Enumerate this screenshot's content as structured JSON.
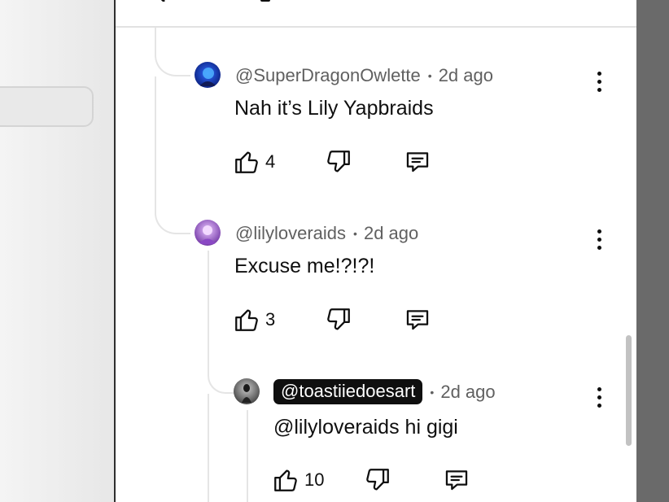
{
  "comments": [
    {
      "author": "@SuperDragonOwlette",
      "time": "2d ago",
      "text": "Nah it’s Lily Yapbraids",
      "likes": "4",
      "avatar_icon": "user-avatar",
      "avatar_colors": [
        "#0b1e7a",
        "#2f6bff"
      ]
    },
    {
      "author": "@lilyloveraids",
      "time": "2d ago",
      "text": "Excuse me!?!?!",
      "likes": "3",
      "avatar_icon": "user-avatar",
      "avatar_colors": [
        "#6b2fa0",
        "#d79ef0"
      ]
    },
    {
      "author": "@toastiiedoesart",
      "time": "2d ago",
      "text": "@lilyloveraids hi gigi",
      "likes": "10",
      "avatar_icon": "user-avatar",
      "avatar_colors": [
        "#3a3a3a",
        "#9a9a9a"
      ],
      "author_highlighted": true
    }
  ],
  "separator": "•",
  "icons": {
    "like": "thumbs-up-icon",
    "dislike": "thumbs-down-icon",
    "reply": "reply-comment-icon",
    "more": "more-vertical-icon"
  },
  "colors": {
    "text": "#0f0f0f",
    "secondary_text": "#606060",
    "highlight_bg": "#0f0f0f",
    "thread_line": "#e5e5e5",
    "right_strip": "#6a6a6a"
  }
}
